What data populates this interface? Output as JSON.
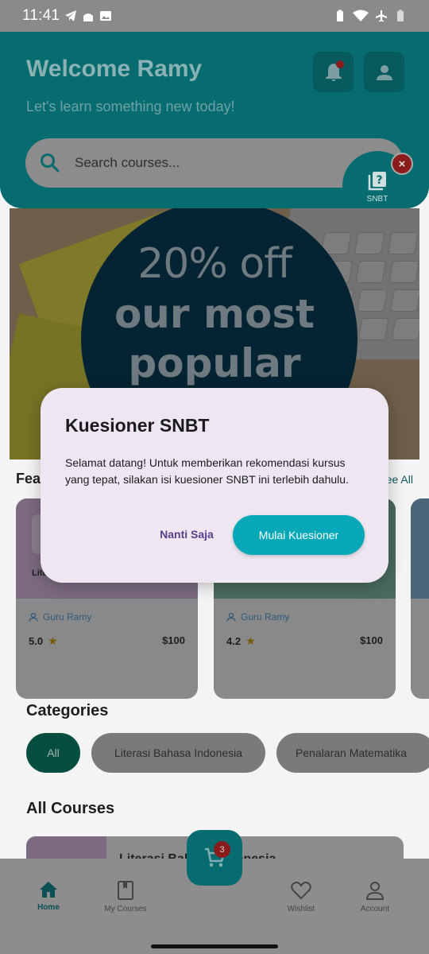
{
  "status_bar": {
    "time": "11:41"
  },
  "header": {
    "welcome": "Welcome Ramy",
    "subtitle": "Let's learn something new today!"
  },
  "search": {
    "placeholder": "Search courses..."
  },
  "snbt_fab": {
    "label": "SNBT"
  },
  "banner": {
    "line1": "20% off",
    "line2": "our most",
    "line3": "popular"
  },
  "featured": {
    "title": "Featured",
    "see_all": "See All",
    "cards": [
      {
        "cover_text": "Lite",
        "instructor": "Guru Ramy",
        "rating": "5.0",
        "price": "$100",
        "cover_color": "#7c6a80"
      },
      {
        "cover_text": "",
        "instructor": "Guru Ramy",
        "rating": "4.2",
        "price": "$100",
        "cover_color": "#4b6a5e"
      }
    ]
  },
  "categories": {
    "title": "Categories",
    "chips": [
      "All",
      "Literasi Bahasa Indonesia",
      "Penalaran Matematika"
    ]
  },
  "all_courses": {
    "title": "All Courses",
    "first_course": "Literasi Bahasa Indonesia"
  },
  "nav": {
    "home": "Home",
    "my_courses": "My Courses",
    "wishlist": "Wishlist",
    "account": "Account"
  },
  "cart": {
    "count": "3"
  },
  "dialog": {
    "title": "Kuesioner SNBT",
    "body": "Selamat datang! Untuk memberikan rekomendasi kursus yang tepat, silakan isi kuesioner SNBT ini terlebih dahulu.",
    "later_label": "Nanti Saja",
    "start_label": "Mulai Kuesioner"
  },
  "colors": {
    "primary": "#066c70",
    "accent": "#07a9b8",
    "dialog_bg": "#eee7f2",
    "badge": "#8a1c1c"
  }
}
